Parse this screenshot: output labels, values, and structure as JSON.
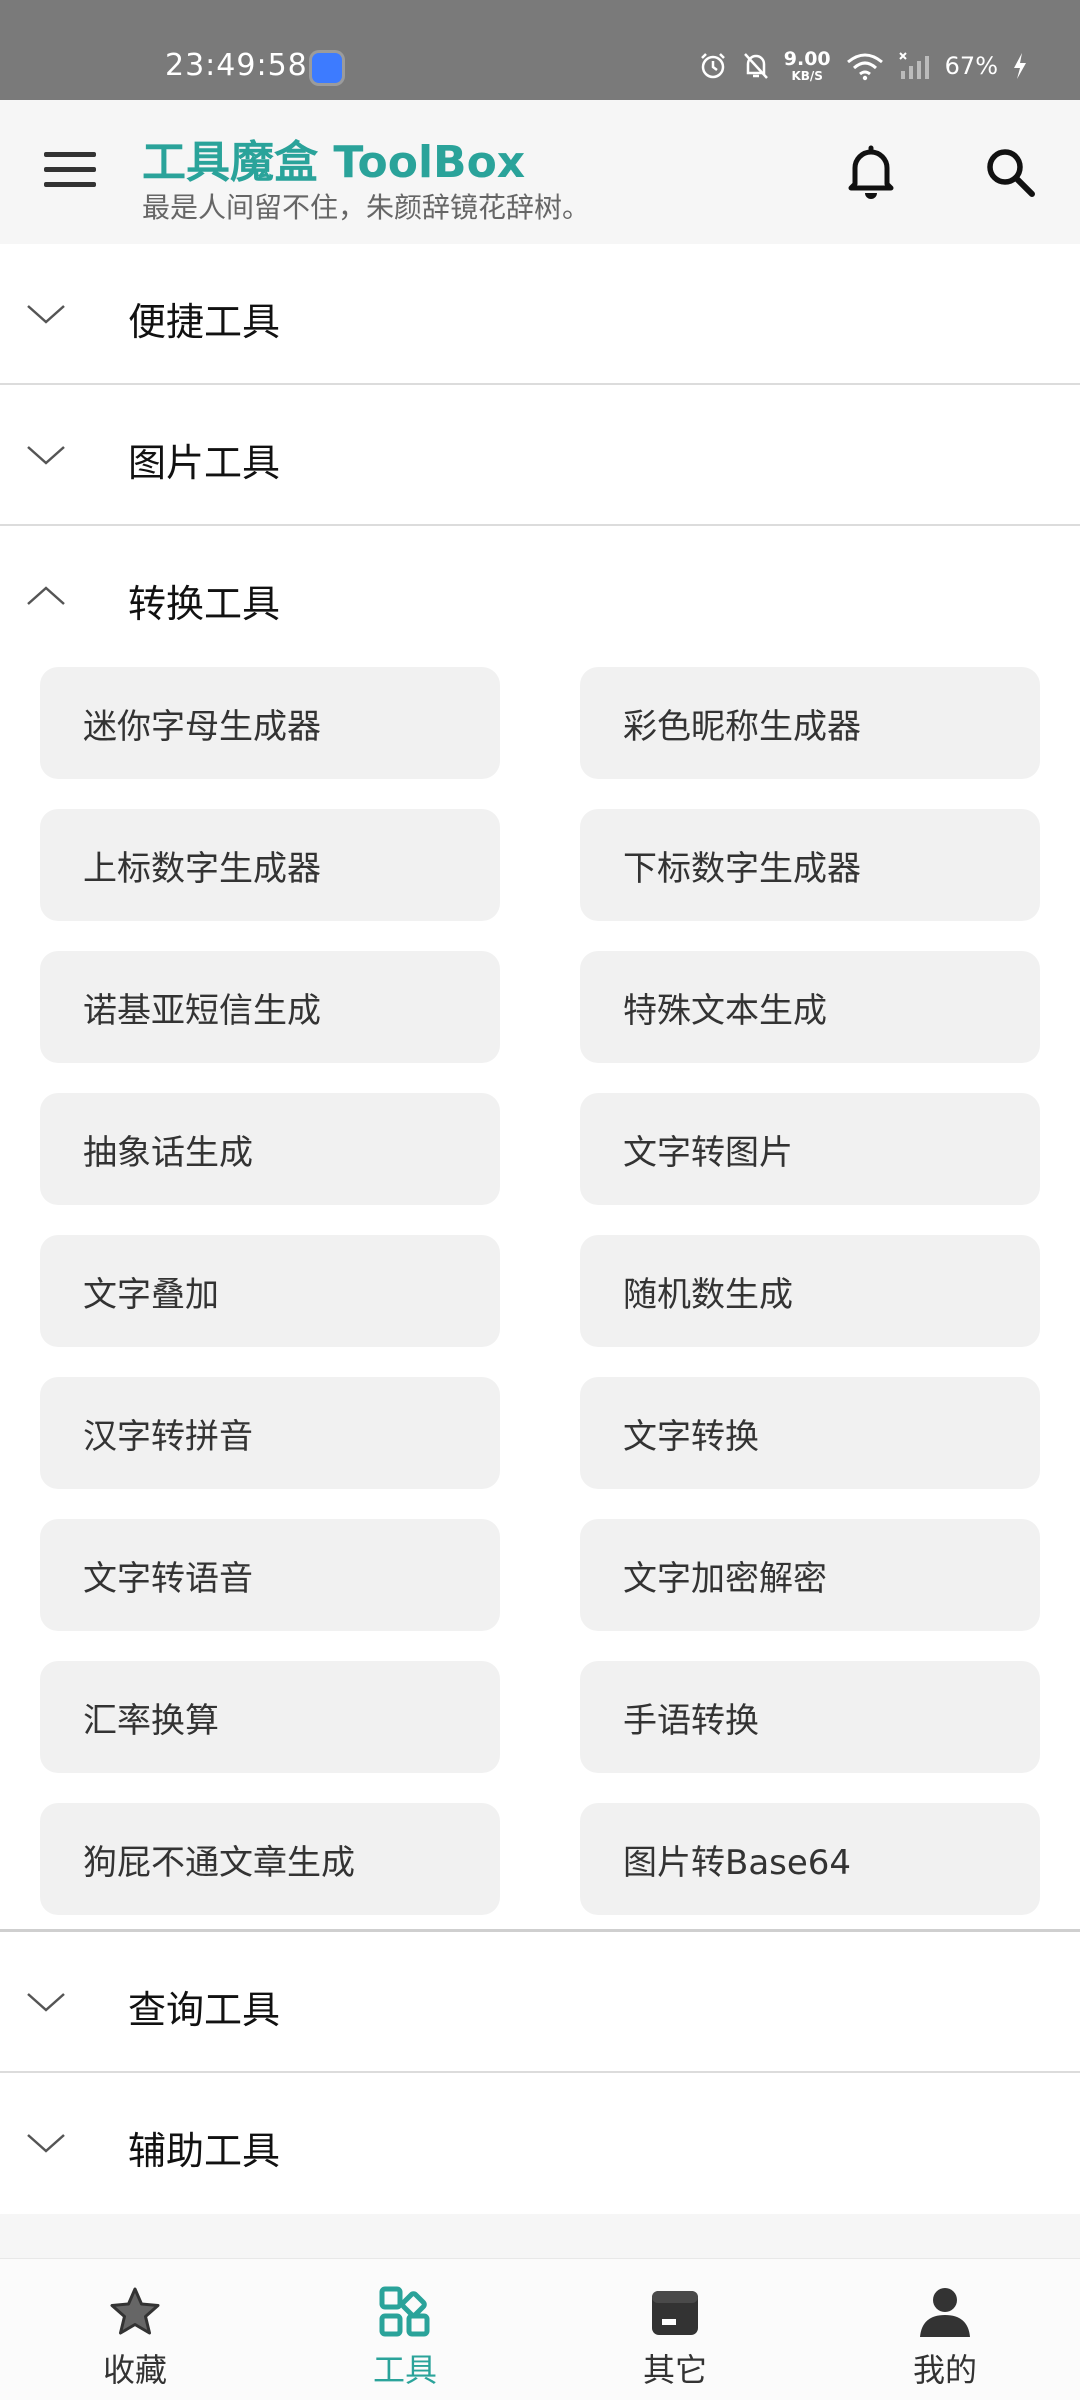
{
  "status_bar": {
    "time": "23:49:58",
    "net_speed_value": "9.00",
    "net_speed_unit": "KB/S",
    "battery": "67%",
    "icons": [
      "app-notification-icon",
      "alarm-icon",
      "mute-bell-icon",
      "wifi-icon",
      "signal-icon",
      "charging-icon"
    ]
  },
  "app_bar": {
    "title": "工具魔盒 ToolBox",
    "subtitle": "最是人间留不住，朱颜辞镜花辞树。",
    "icons": [
      "menu-icon",
      "bell-icon",
      "search-icon"
    ],
    "accent_color": "#2aa39a"
  },
  "sections": [
    {
      "label": "便捷工具",
      "expanded": false
    },
    {
      "label": "图片工具",
      "expanded": false
    },
    {
      "label": "转换工具",
      "expanded": true
    },
    {
      "label": "查询工具",
      "expanded": false
    },
    {
      "label": "辅助工具",
      "expanded": false
    }
  ],
  "conversion_tools": [
    "迷你字母生成器",
    "彩色昵称生成器",
    "上标数字生成器",
    "下标数字生成器",
    "诺基亚短信生成",
    "特殊文本生成",
    "抽象话生成",
    "文字转图片",
    "文字叠加",
    "随机数生成",
    "汉字转拼音",
    "文字转换",
    "文字转语音",
    "文字加密解密",
    "汇率换算",
    "手语转换",
    "狗屁不通文章生成",
    "图片转Base64"
  ],
  "bottom_nav": [
    {
      "label": "收藏",
      "icon": "star-icon",
      "active": false
    },
    {
      "label": "工具",
      "icon": "grid-tools-icon",
      "active": true
    },
    {
      "label": "其它",
      "icon": "box-icon",
      "active": false
    },
    {
      "label": "我的",
      "icon": "person-icon",
      "active": false
    }
  ]
}
